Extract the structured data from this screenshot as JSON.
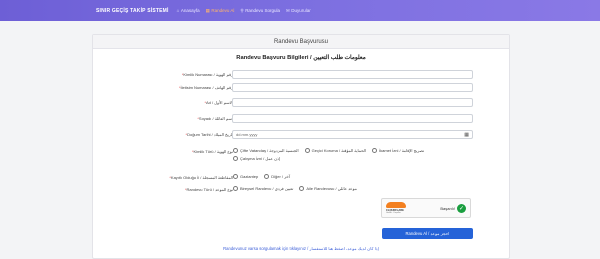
{
  "nav": {
    "brand": "SINIR GEÇİŞ TAKİP SİSTEMİ",
    "items": [
      {
        "label": "Anasayfa",
        "icon": "⌂"
      },
      {
        "label": "Randevu Al",
        "icon": "▦"
      },
      {
        "label": "Randevu Sorgula",
        "icon": "⚲"
      },
      {
        "label": "Duyurular",
        "icon": "✉"
      }
    ],
    "active_color": "#ffb36a"
  },
  "card": {
    "header": "Randevu Başvurusu",
    "section_title": "Randevu Başvuru Bilgileri / معلومات طلب التعيين"
  },
  "form": {
    "kimlik_no": {
      "label": "Kimlik Numarası / رقم الهوية",
      "value": ""
    },
    "iletisim": {
      "label": "İletisim Numarası / رقم الهاتف",
      "value": ""
    },
    "ad": {
      "label": "Ad / الاسم الأول",
      "value": ""
    },
    "soyad": {
      "label": "Soyadı / اسم العائلة",
      "value": ""
    },
    "dogum": {
      "label": "Doğum Tarihi / تاريخ الميلاد",
      "placeholder": "dd.mm.yyyy",
      "value": ""
    },
    "kimlik_turu": {
      "label": "Kimlik Türü / نوع الهوية",
      "options": [
        "Çifte Vatandaş / الجنسية المزدوجة",
        "Geçici Koruma / الحماية المؤقتة",
        "İkamet İzni / تصريح الإقامة",
        "Çalışma İzni / إذن عمل"
      ]
    },
    "kayit": {
      "label": "Kayıtlı Olduğu İl / المقاطعة المسجلة",
      "options": [
        "Gaziantep",
        "Diğer / آخر"
      ]
    },
    "randevu_turu": {
      "label": "Randevu Türü / نوع الموعد",
      "options": [
        "Bireysel Randevu / تعيين فردي",
        "Aile Randevusu / موعد عائلي"
      ]
    }
  },
  "captcha": {
    "status": "Başarılı!",
    "brand": "CLOUDFLARE",
    "sub": "Gizlilik · Koşullar"
  },
  "submit_label": "Randevu Al / احجز موعد",
  "footer_link": "Randevunuz varsa sorgulamak için tıklayınız / إذا كان لديك موعد، اضغط هنا للاستفسار"
}
